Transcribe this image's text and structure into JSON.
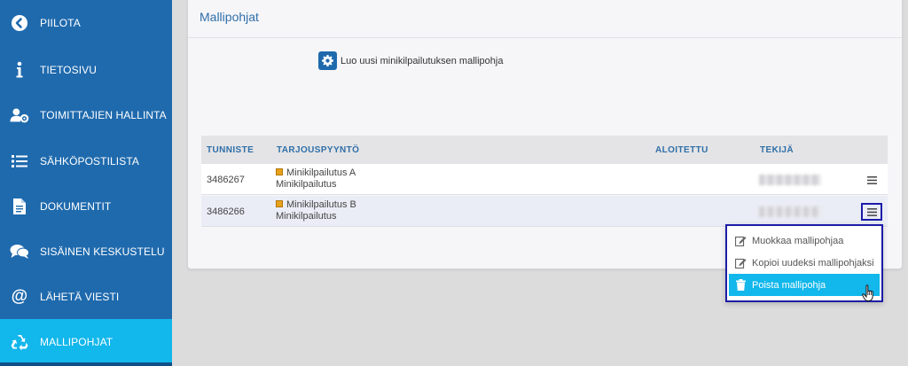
{
  "sidebar": {
    "items": [
      {
        "label": "PIILOTA",
        "icon": "chevron-left-circle-icon"
      },
      {
        "label": "TIETOSIVU",
        "icon": "info-icon"
      },
      {
        "label": "TOIMITTAJIEN HALLINTA",
        "icon": "user-gear-icon"
      },
      {
        "label": "SÄHKÖPOSTILISTA",
        "icon": "list-icon"
      },
      {
        "label": "DOKUMENTIT",
        "icon": "document-icon"
      },
      {
        "label": "SISÄINEN KESKUSTELU",
        "icon": "chat-icon"
      },
      {
        "label": "LÄHETÄ VIESTI",
        "icon": "at-icon"
      },
      {
        "label": "MALLIPOHJAT",
        "icon": "recycle-icon",
        "active": true
      }
    ]
  },
  "panel": {
    "title": "Mallipohjat",
    "create_label": "Luo uusi minikilpailutuksen mallipohja"
  },
  "table": {
    "columns": [
      "TUNNISTE",
      "TARJOUSPYYNTÖ",
      "ALOITETTU",
      "TEKIJÄ"
    ],
    "rows": [
      {
        "id": "3486267",
        "name": "Minikilpailutus A",
        "type": "Minikilpailutus",
        "started": "",
        "author": ""
      },
      {
        "id": "3486266",
        "name": "Minikilpailutus B",
        "type": "Minikilpailutus",
        "started": "",
        "author": ""
      }
    ]
  },
  "dropdown": {
    "items": [
      {
        "label": "Muokkaa mallipohjaa",
        "icon": "edit-icon"
      },
      {
        "label": "Kopioi uudeksi mallipohjaksi",
        "icon": "edit-icon"
      },
      {
        "label": "Poista mallipohja",
        "icon": "trash-icon",
        "active": true
      }
    ]
  },
  "colors": {
    "sidebar": "#1f6aad",
    "sidebar_active": "#12b7eb",
    "accent_text": "#2f6fa8",
    "highlight_border": "#1c1ca8"
  }
}
